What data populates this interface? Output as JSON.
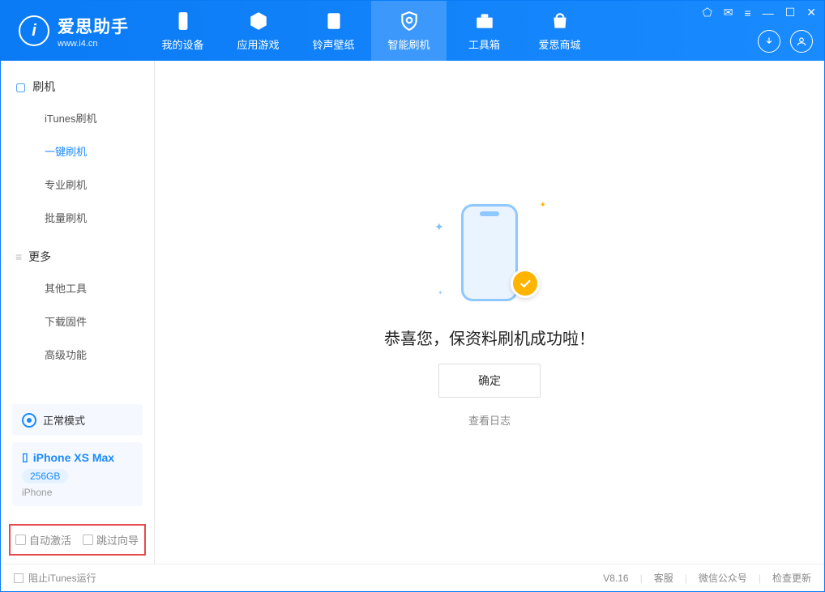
{
  "logo": {
    "letter": "i",
    "cn": "爱思助手",
    "en": "www.i4.cn"
  },
  "header": {
    "tabs": [
      {
        "label": "我的设备",
        "icon": "device"
      },
      {
        "label": "应用游戏",
        "icon": "cube"
      },
      {
        "label": "铃声壁纸",
        "icon": "music"
      },
      {
        "label": "智能刷机",
        "icon": "shield",
        "active": true
      },
      {
        "label": "工具箱",
        "icon": "toolbox"
      },
      {
        "label": "爱思商城",
        "icon": "bag"
      }
    ]
  },
  "win_icons": {
    "cloth": "⬠",
    "feedback": "✉",
    "menu": "≡",
    "min": "—",
    "max": "☐",
    "close": "✕"
  },
  "sidebar": {
    "section1": {
      "title": "刷机",
      "items": [
        "iTunes刷机",
        "一键刷机",
        "专业刷机",
        "批量刷机"
      ],
      "activeIndex": 1
    },
    "section2": {
      "title": "更多",
      "items": [
        "其他工具",
        "下载固件",
        "高级功能"
      ]
    }
  },
  "device": {
    "mode": "正常模式",
    "name": "iPhone XS Max",
    "capacity": "256GB",
    "type": "iPhone"
  },
  "options": {
    "opt1": "自动激活",
    "opt2": "跳过向导"
  },
  "main": {
    "message": "恭喜您，保资料刷机成功啦！",
    "ok": "确定",
    "log": "查看日志"
  },
  "footer": {
    "itunes": "阻止iTunes运行",
    "version": "V8.16",
    "service": "客服",
    "wechat": "微信公众号",
    "update": "检查更新"
  }
}
